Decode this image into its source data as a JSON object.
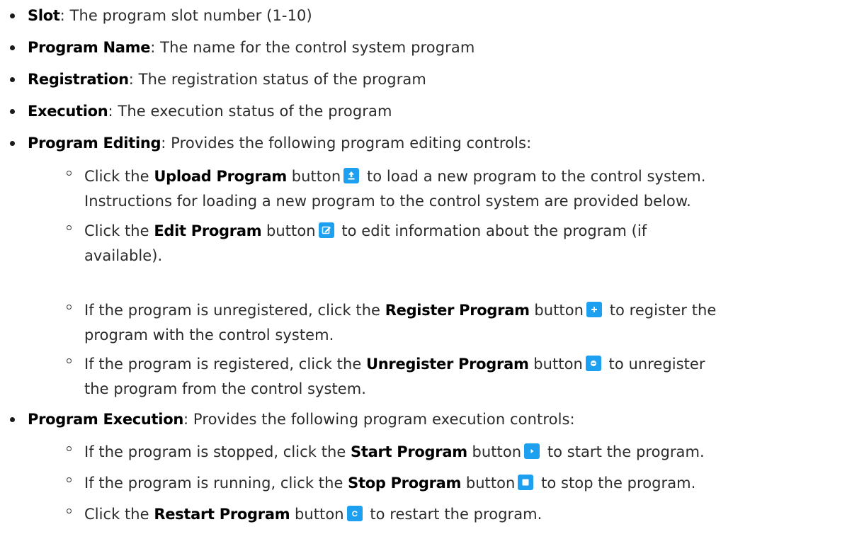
{
  "accent_color": "#1ea0f0",
  "bullets": [
    {
      "term": "Slot",
      "desc": ": The program slot number (1-10)"
    },
    {
      "term": "Program Name",
      "desc": ": The name for the control system program"
    },
    {
      "term": "Registration",
      "desc": ": The registration status of the program"
    },
    {
      "term": "Execution",
      "desc": ": The execution status of the program"
    },
    {
      "term": "Program Editing",
      "desc": ": Provides the following program editing controls:"
    },
    {
      "term": "Program Execution",
      "desc": ": Provides the following program execution controls:"
    }
  ],
  "editing": [
    {
      "pre": "Click the ",
      "term": "Upload Program",
      "mid": " button",
      "icon": "upload-icon",
      "post": " to load a new program to the control system.",
      "line2": "Instructions for loading a new program to the control system are provided below."
    },
    {
      "pre": "Click the ",
      "term": "Edit Program",
      "mid": " button",
      "icon": "edit-icon",
      "post": " to edit information about the program (if",
      "line2": "available)."
    },
    {
      "pre": "If the program is unregistered, click the ",
      "term": "Register Program",
      "mid": " button",
      "icon": "plus-icon",
      "post": " to register the",
      "line2": "program with the control system."
    },
    {
      "pre": "If the program is registered, click the ",
      "term": "Unregister Program",
      "mid": " button",
      "icon": "minus-icon",
      "post": " to unregister",
      "line2": "the program from the control system."
    }
  ],
  "execution": [
    {
      "pre": "If the program is stopped, click the ",
      "term": "Start Program",
      "mid": " button",
      "icon": "play-icon",
      "post": " to start the program."
    },
    {
      "pre": "If the program is running, click the ",
      "term": "Stop Program",
      "mid": " button",
      "icon": "stop-icon",
      "post": " to stop the program."
    },
    {
      "pre": "Click the ",
      "term": "Restart Program",
      "mid": " button",
      "icon": "restart-icon",
      "post": " to restart the program."
    }
  ]
}
